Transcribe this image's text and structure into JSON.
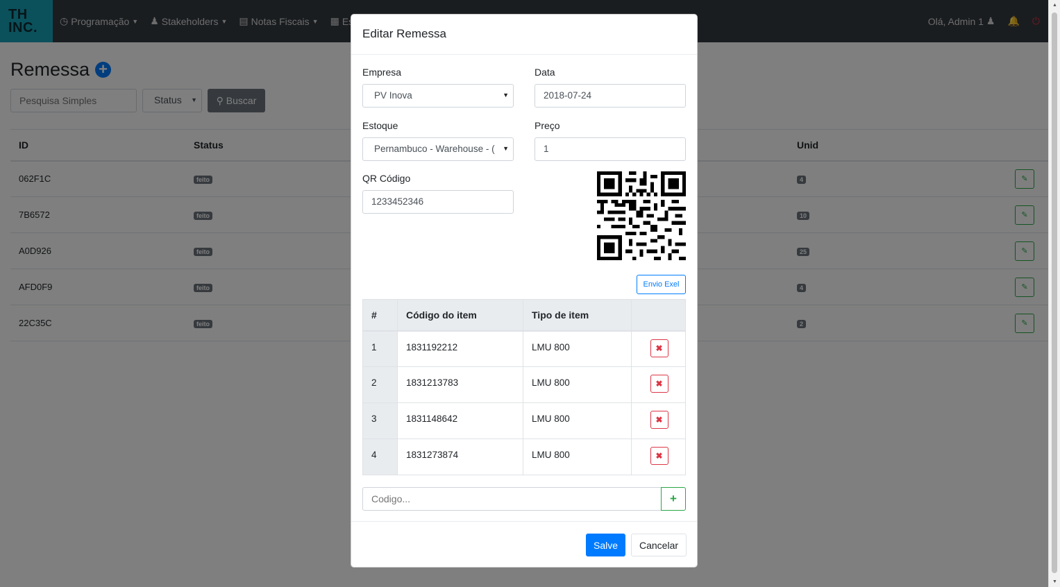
{
  "brand": {
    "line1": "TH",
    "line2": "INC."
  },
  "nav": {
    "items": [
      {
        "label": "Programação",
        "icon": "clock-icon"
      },
      {
        "label": "Stakeholders",
        "icon": "users-icon"
      },
      {
        "label": "Notas Fiscais",
        "icon": "document-icon"
      },
      {
        "label": "Estoque",
        "icon": "grid-icon"
      }
    ],
    "greeting": "Olá, Admin 1"
  },
  "page": {
    "title": "Remessa",
    "search_placeholder": "Pesquisa Simples",
    "status_filter": "Status",
    "search_button": "Buscar"
  },
  "table": {
    "headers": {
      "id": "ID",
      "status": "Status",
      "unid": "Unid"
    },
    "rows": [
      {
        "id": "062F1C",
        "status": "feito",
        "unid": "4"
      },
      {
        "id": "7B6572",
        "status": "feito",
        "unid": "10"
      },
      {
        "id": "A0D926",
        "status": "feito",
        "unid": "25"
      },
      {
        "id": "AFD0F9",
        "status": "feito",
        "unid": "4"
      },
      {
        "id": "22C35C",
        "status": "feito",
        "unid": "2"
      }
    ]
  },
  "modal": {
    "title": "Editar Remessa",
    "empresa_label": "Empresa",
    "empresa_value": "PV Inova",
    "data_label": "Data",
    "data_value": "2018-07-24",
    "estoque_label": "Estoque",
    "estoque_value": "Pernambuco - Warehouse - (",
    "preco_label": "Preço",
    "preco_value": "1",
    "qr_label": "QR Código",
    "qr_value": "1233452346",
    "envio_button": "Envio Exel",
    "items_headers": {
      "num": "#",
      "code": "Código do item",
      "type": "Tipo de item"
    },
    "items": [
      {
        "num": "1",
        "code": "1831192212",
        "type": "LMU 800"
      },
      {
        "num": "2",
        "code": "1831213783",
        "type": "LMU 800"
      },
      {
        "num": "3",
        "code": "1831148642",
        "type": "LMU 800"
      },
      {
        "num": "4",
        "code": "1831273874",
        "type": "LMU 800"
      }
    ],
    "code_placeholder": "Codigo...",
    "save_button": "Salve",
    "cancel_button": "Cancelar"
  },
  "colors": {
    "primary": "#007bff",
    "success": "#28a745",
    "danger": "#dc3545",
    "navbar": "#343a40",
    "brand": "#17a2b8"
  }
}
